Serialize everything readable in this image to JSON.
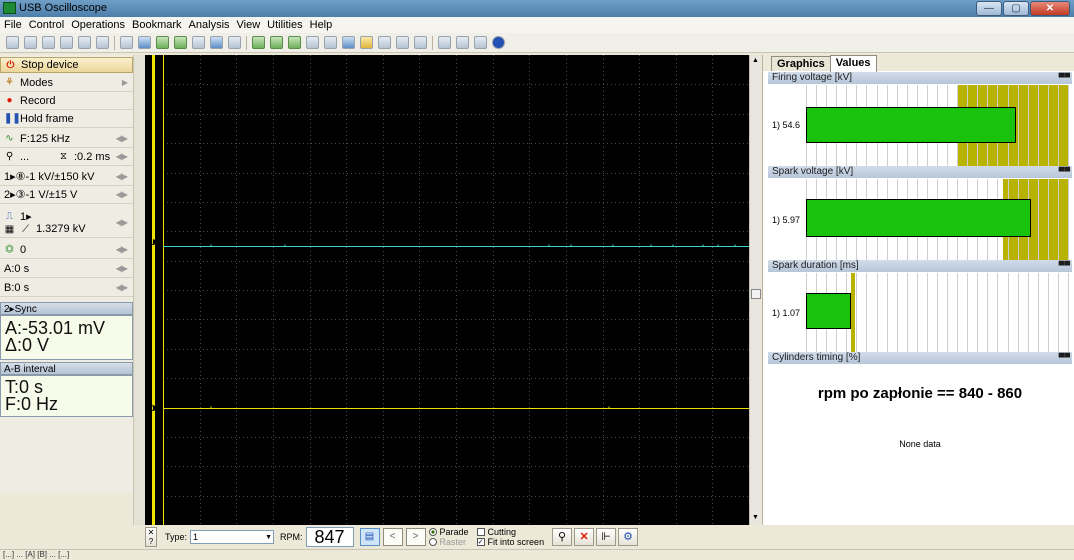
{
  "window": {
    "title": "USB Oscilloscope"
  },
  "menu": [
    "File",
    "Control",
    "Operations",
    "Bookmark",
    "Analysis",
    "View",
    "Utilities",
    "Help"
  ],
  "left": {
    "stop": "Stop device",
    "modes": "Modes",
    "record": "Record",
    "hold": "Hold frame",
    "freq": "F:125 kHz",
    "time_prefix": "...",
    "time": ":0.2 ms",
    "ch1": "1▸⑧-1 kV/±150 kV",
    "ch2": "2▸③-1 V/±15 V",
    "trig_line1": "1▸",
    "trig_value": "1.3279 kV",
    "offset": "0",
    "cursor_a": "A:0 s",
    "cursor_b": "B:0 s",
    "sync_title": "2▸Sync",
    "sync_a": "A:-53.01 mV",
    "sync_delta": "Δ:0 V",
    "ab_title": "A-B interval",
    "ab_t": "T:0 s",
    "ab_f": "F:0 Hz"
  },
  "scope": {
    "ch1_marker": "1▸",
    "ch2_marker": "2▸",
    "ch1_color": "#3fd0d0",
    "ch2_color": "#e8e000"
  },
  "right": {
    "tabs": [
      "Graphics",
      "Values"
    ],
    "active_tab": "Values",
    "panels": [
      {
        "title": "Firing voltage [kV]",
        "label": "1) 54.6",
        "value": 54.6,
        "fill": 0.8,
        "band_from": 0.58
      },
      {
        "title": "Spark voltage [kV]",
        "label": "1) 5.97",
        "value": 5.97,
        "fill": 0.86,
        "band_from": 0.75
      },
      {
        "title": "Spark duration [ms]",
        "label": "1) 1.07",
        "value": 1.07,
        "fill": 0.17,
        "band_from": 0.17
      },
      {
        "title": "Cylinders timing [%]"
      }
    ],
    "rpm_note": "rpm po zapłonie == 840 - 860",
    "none_data": "None data"
  },
  "bottom": {
    "type_label": "Type:",
    "type_value": "1",
    "rpm_label": "RPM:",
    "rpm_value": "847",
    "parade": "Parade",
    "raster": "Raster",
    "cutting": "Cutting",
    "fit": "Fit into screen"
  },
  "status": "[...] ...  [A]  [B]  ...  [...]"
}
